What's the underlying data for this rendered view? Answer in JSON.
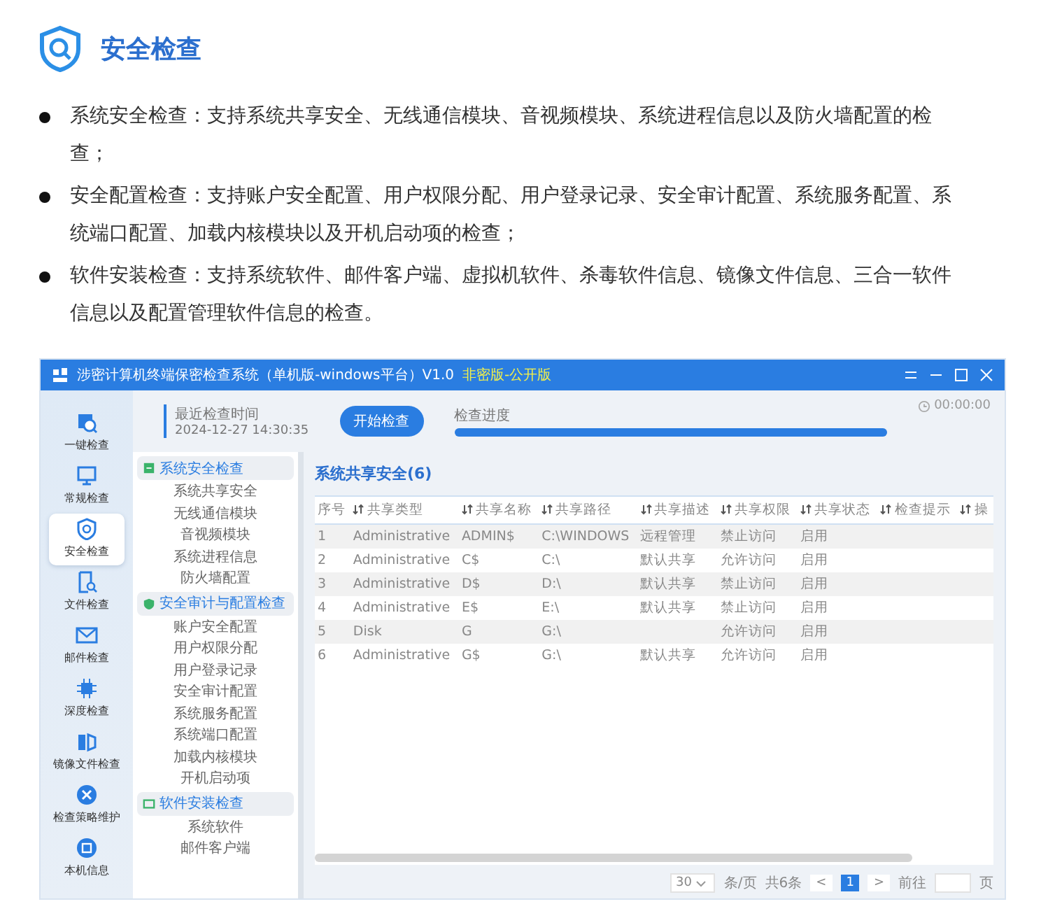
{
  "section": {
    "title": "安全检查",
    "bullets": [
      "系统安全检查：支持系统共享安全、无线通信模块、音视频模块、系统进程信息以及防火墙配置的检查；",
      "安全配置检查：支持账户安全配置、用户权限分配、用户登录记录、安全审计配置、系统服务配置、系统端口配置、加载内核模块以及开机启动项的检查；",
      "软件安装检查：支持系统软件、邮件客户端、虚拟机软件、杀毒软件信息、镜像文件信息、三合一软件信息以及配置管理软件信息的检查。"
    ]
  },
  "app": {
    "title": "涉密计算机终端保密检查系统（单机版-windows平台）V1.0",
    "edition": "非密版-公开版",
    "sidebar": [
      {
        "label": "一键检查",
        "selected": false
      },
      {
        "label": "常规检查",
        "selected": false
      },
      {
        "label": "安全检查",
        "selected": true
      },
      {
        "label": "文件检查",
        "selected": false
      },
      {
        "label": "邮件检查",
        "selected": false
      },
      {
        "label": "深度检查",
        "selected": false
      },
      {
        "label": "镜像文件检查",
        "selected": false
      },
      {
        "label": "检查策略维护",
        "selected": false
      },
      {
        "label": "本机信息",
        "selected": false
      }
    ],
    "nav": [
      {
        "heading": "系统安全检查",
        "items": [
          "系统共享安全",
          "无线通信模块",
          "音视频模块",
          "系统进程信息",
          "防火墙配置"
        ]
      },
      {
        "heading": "安全审计与配置检查",
        "items": [
          "账户安全配置",
          "用户权限分配",
          "用户登录记录",
          "安全审计配置",
          "系统服务配置",
          "系统端口配置",
          "加载内核模块",
          "开机启动项"
        ]
      },
      {
        "heading": "软件安装检查",
        "items": [
          "系统软件",
          "邮件客户端"
        ]
      }
    ],
    "last_check": {
      "label": "最近检查时间",
      "time": "2024-12-27 14:30:35"
    },
    "start_button": "开始检查",
    "progress": {
      "label": "检查进度",
      "level": 1
    },
    "timer": "00:00:00",
    "table": {
      "title": "系统共享安全(6)",
      "columns": [
        "序号",
        "共享类型",
        "共享名称",
        "共享路径",
        "共享描述",
        "共享权限",
        "共享状态",
        "检查提示",
        "操"
      ],
      "rows": [
        [
          "1",
          "Administrative",
          "ADMIN$",
          "C:\\WINDOWS",
          "远程管理",
          "禁止访问",
          "启用",
          ""
        ],
        [
          "2",
          "Administrative",
          "C$",
          "C:\\",
          "默认共享",
          "允许访问",
          "启用",
          ""
        ],
        [
          "3",
          "Administrative",
          "D$",
          "D:\\",
          "默认共享",
          "禁止访问",
          "启用",
          ""
        ],
        [
          "4",
          "Administrative",
          "E$",
          "E:\\",
          "默认共享",
          "禁止访问",
          "启用",
          ""
        ],
        [
          "5",
          "Disk",
          "G",
          "G:\\",
          "",
          "允许访问",
          "启用",
          ""
        ],
        [
          "6",
          "Administrative",
          "G$",
          "G:\\",
          "默认共享",
          "允许访问",
          "启用",
          ""
        ]
      ]
    },
    "pagination": {
      "page_size": "30",
      "per_page": "条/页",
      "total": "共6条",
      "prev": "<",
      "pages": [
        {
          "label": "1",
          "selected": true
        }
      ],
      "next": ">",
      "goto": "前往",
      "page_unit": "页"
    }
  }
}
